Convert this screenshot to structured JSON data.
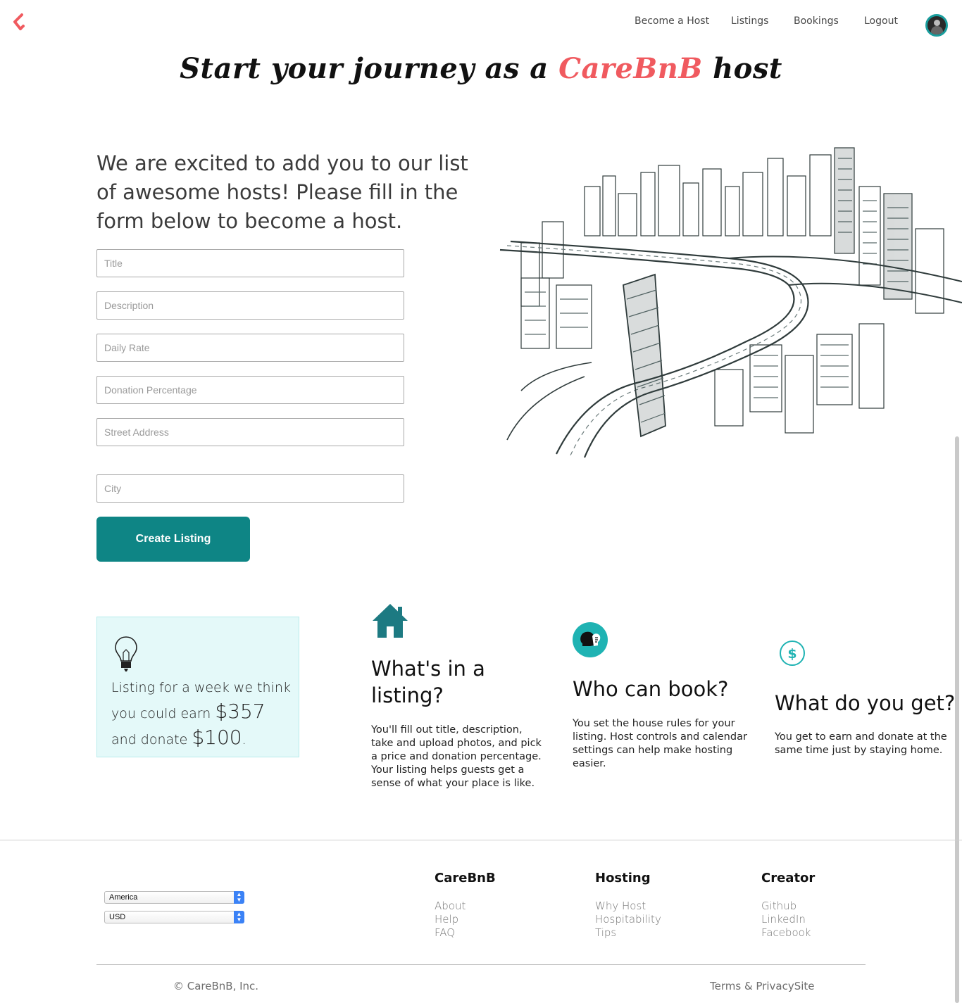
{
  "nav": {
    "logo_icon": "carebnb-chevron-logo",
    "links": [
      "Become a Host",
      "Listings",
      "Bookings",
      "Logout"
    ],
    "avatar_icon": "user-avatar"
  },
  "hero": {
    "title_before": "Start your journey as a ",
    "title_brand": "CareBnB",
    "title_after": " host",
    "brand_color": "#f05a5f"
  },
  "form": {
    "intro": "We are excited to add you to our list of awesome hosts! Please fill in the form below to become a host.",
    "fields": [
      {
        "placeholder": "Title",
        "value": ""
      },
      {
        "placeholder": "Description",
        "value": ""
      },
      {
        "placeholder": "Daily Rate",
        "value": ""
      },
      {
        "placeholder": "Donation Percentage",
        "value": ""
      },
      {
        "placeholder": "Street Address",
        "value": ""
      },
      {
        "placeholder": "City",
        "value": ""
      }
    ],
    "submit_label": "Create Listing",
    "accent_color": "#0e8585"
  },
  "illustration": {
    "icon": "city-sketch-illustration"
  },
  "earn_card": {
    "icon": "lightbulb-icon",
    "line1": "Listing for a week we think you could earn ",
    "earn_amount": "$357",
    "line2": " and donate ",
    "donate_amount": "$100",
    "line3": "."
  },
  "features": [
    {
      "icon": "house-icon",
      "title": "What's in a listing?",
      "description": "You'll fill out title, description, take and upload photos, and pick a price and donation percentage. Your listing helps guests get a sense of what your place is like."
    },
    {
      "icon": "people-icon",
      "title": "Who can book?",
      "description": "You set the house rules for your listing. Host controls and calendar settings can help make hosting easier."
    },
    {
      "icon": "dollar-icon",
      "title": "What do you get?",
      "description": "You get to earn and donate at the same time just by staying home."
    }
  ],
  "footer": {
    "country_select": "America",
    "currency_select": "USD",
    "columns": [
      {
        "title": "CareBnB",
        "links": [
          "About",
          "Help",
          "FAQ"
        ]
      },
      {
        "title": "Hosting",
        "links": [
          "Why Host",
          "Hospitability",
          "Tips"
        ]
      },
      {
        "title": "Creator",
        "links": [
          "Github",
          "LinkedIn",
          "Facebook"
        ]
      }
    ],
    "copyright": "© CareBnB, Inc.",
    "terms": "Terms & PrivacySite"
  }
}
